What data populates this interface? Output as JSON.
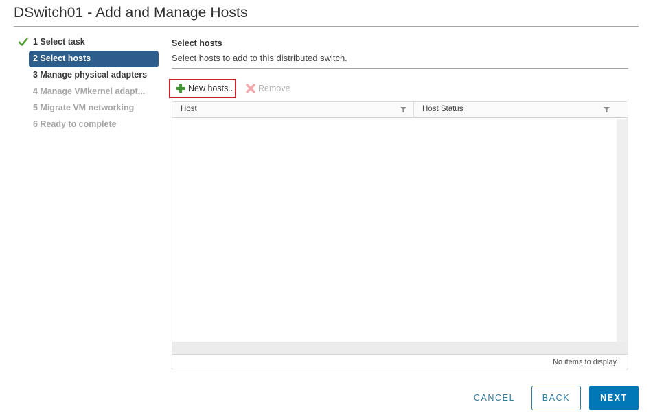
{
  "window": {
    "title": "DSwitch01 - Add and Manage Hosts"
  },
  "steps": [
    {
      "label": "1 Select task",
      "state": "completed"
    },
    {
      "label": "2 Select hosts",
      "state": "active"
    },
    {
      "label": "3 Manage physical adapters",
      "state": "enabled"
    },
    {
      "label": "4 Manage VMkernel adapt...",
      "state": "disabled"
    },
    {
      "label": "5 Migrate VM networking",
      "state": "disabled"
    },
    {
      "label": "6 Ready to complete",
      "state": "disabled"
    }
  ],
  "section": {
    "title": "Select hosts",
    "description": "Select hosts to add to this distributed switch."
  },
  "toolbar": {
    "new_hosts_label": "New hosts..",
    "new_hosts_icon": "plus-icon",
    "remove_label": "Remove",
    "remove_icon": "x-icon"
  },
  "grid": {
    "columns": [
      {
        "label": "Host",
        "filter_icon": "filter-icon"
      },
      {
        "label": "Host Status",
        "filter_icon": "filter-icon"
      }
    ],
    "rows": [],
    "footer": "No items to display"
  },
  "buttons": {
    "cancel": "CANCEL",
    "back": "BACK",
    "next": "NEXT"
  },
  "colors": {
    "active_step": "#2d5d8a",
    "primary": "#0277b8",
    "link": "#2c7aa0",
    "highlight_box": "#cc2229",
    "check": "#4a9a2f",
    "add_icon": "#3d9a2e",
    "remove_icon": "#f2a9ad"
  }
}
